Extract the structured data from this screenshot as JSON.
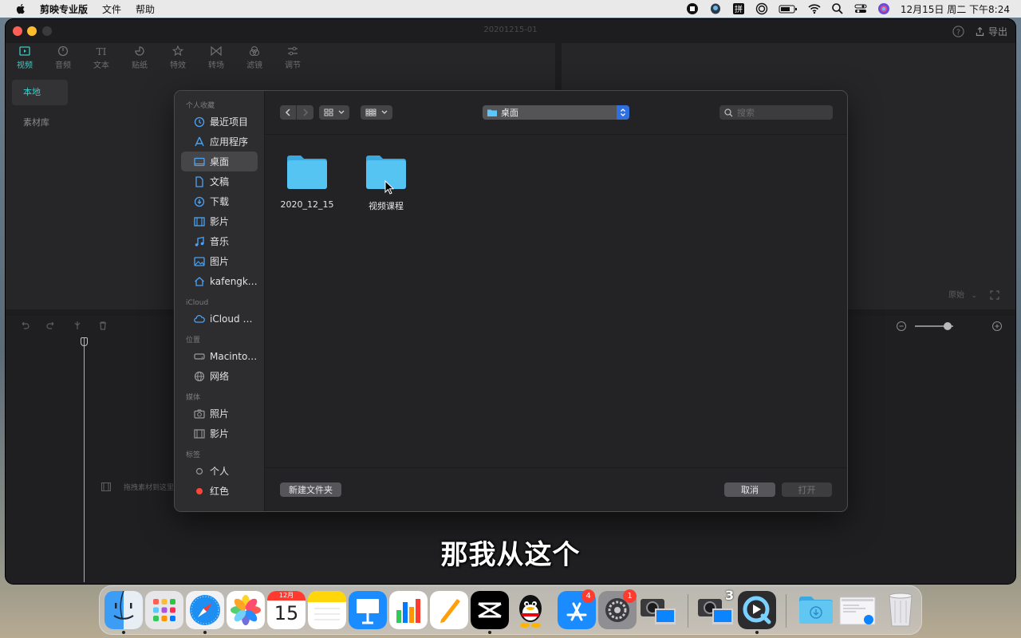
{
  "menubar": {
    "app_name": "剪映专业版",
    "menus": [
      "文件",
      "帮助"
    ],
    "clock": "12月15日 周二 下午8:24"
  },
  "window": {
    "title": "20201215-01",
    "export_label": "导出",
    "media_tabs": [
      "视频",
      "音频",
      "文本",
      "贴纸",
      "特效",
      "转场",
      "滤镜",
      "调节"
    ],
    "side_nav": [
      "本地",
      "素材库"
    ],
    "preview_ratio": "原始",
    "drop_hint": "拖拽素材到这里"
  },
  "dialog": {
    "sidebar": {
      "favorites_header": "个人收藏",
      "favorites": [
        "最近项目",
        "应用程序",
        "桌面",
        "文稿",
        "下载",
        "影片",
        "音乐",
        "图片",
        "kafengkaj..."
      ],
      "icloud_header": "iCloud",
      "icloud": [
        "iCloud 云盘"
      ],
      "locations_header": "位置",
      "locations": [
        "Macintos...",
        "网络"
      ],
      "media_header": "媒体",
      "media": [
        "照片",
        "影片"
      ],
      "tags_header": "标签",
      "tags": [
        "个人",
        "红色"
      ]
    },
    "location": "桌面",
    "search_placeholder": "搜索",
    "files": [
      "2020_12_15",
      "视频课程"
    ],
    "new_folder_label": "新建文件夹",
    "cancel_label": "取消",
    "open_label": "打开"
  },
  "subtitle": "那我从这个",
  "dock": {
    "apps": [
      "Finder",
      "Launchpad",
      "Safari",
      "Photos",
      "Calendar",
      "Notes",
      "Keynote",
      "Numbers",
      "Pages",
      "CapCut",
      "QQ",
      "App Store",
      "System Preferences",
      "Screenshot",
      "Screenshot 2",
      "QuickTime Player",
      "Downloads",
      "Preview"
    ],
    "calendar_month": "12月",
    "calendar_day": "15",
    "appstore_badge": "4",
    "sysprefs_badge": "1",
    "stack_count": "3"
  },
  "colors": {
    "accent_teal": "#3fc9c3",
    "select_blue": "#2f6fde",
    "folder_blue": "#4fc0f0"
  }
}
